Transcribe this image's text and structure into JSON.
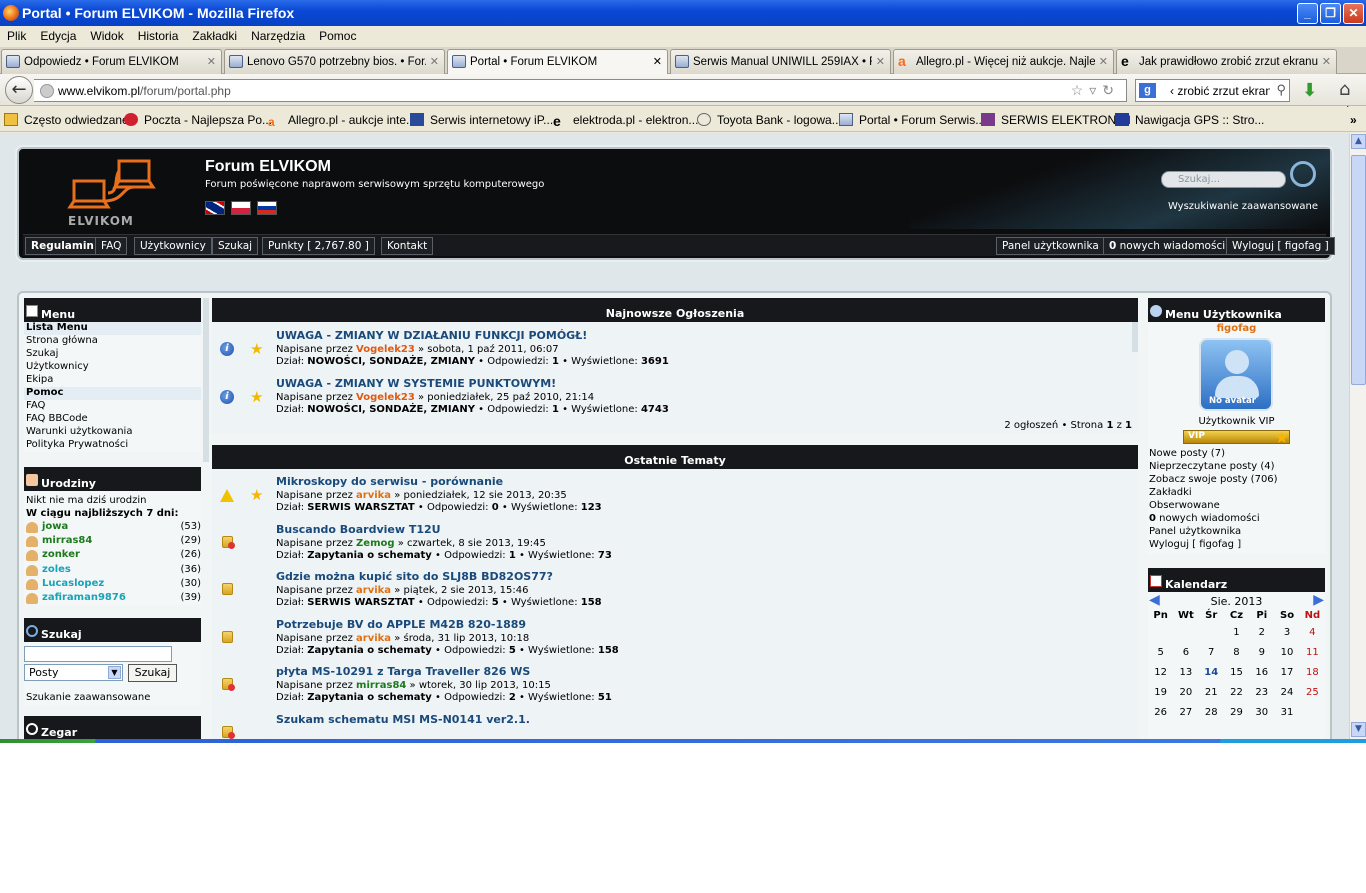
{
  "window": {
    "title": "Portal • Forum ELVIKOM - Mozilla Firefox"
  },
  "menu": [
    "Plik",
    "Edycja",
    "Widok",
    "Historia",
    "Zakładki",
    "Narzędzia",
    "Pomoc"
  ],
  "tabs": [
    {
      "label": "Odpowiedz • Forum ELVIKOM"
    },
    {
      "label": "Lenovo G570 potrzebny bios. • For..."
    },
    {
      "label": "Portal • Forum ELVIKOM"
    },
    {
      "label": "Serwis Manual UNIWILL 259IAX • F..."
    },
    {
      "label": "Allegro.pl - Więcej niż aukcje. Najle..."
    },
    {
      "label": "Jak prawidłowo zrobić zrzut ekranu..."
    }
  ],
  "nav": {
    "url_domain": "www.elvikom.pl",
    "url_path": "/forum/portal.php",
    "search_value": "‹ zrobić zrzut ekranu"
  },
  "bookmarks": [
    "Często odwiedzane",
    "Poczta - Najlepsza Po...",
    "Allegro.pl - aukcje inte...",
    "Serwis internetowy iP...",
    "elektroda.pl - elektron...",
    "Toyota Bank - logowa...",
    "Portal • Forum Serwis...",
    "SERWIS ELEKTRONIKI",
    "Nawigacja GPS :: Stro..."
  ],
  "header": {
    "logo_text": "ELVIKOM",
    "title": "Forum ELVIKOM",
    "description": "Forum poświęcone naprawom serwisowym sprzętu komputerowego",
    "search_placeholder": "Szukaj...",
    "advanced_search": "Wyszukiwanie zaawansowane",
    "nav_left": [
      "Regulamin",
      "FAQ",
      "Użytkownicy",
      "Szukaj",
      "Punkty  [ 2,767.80 ]",
      "Kontakt"
    ],
    "nav_panel": "Panel użytkownika",
    "nav_messages_count": "0",
    "nav_messages": " nowych wiadomości",
    "nav_logout": "Wyloguj [ figofag ]"
  },
  "left": {
    "menu_title": "Menu",
    "menu_items": [
      {
        "label": "Lista Menu",
        "hl": true
      },
      {
        "label": "Strona główna"
      },
      {
        "label": "Szukaj"
      },
      {
        "label": "Użytkownicy"
      },
      {
        "label": "Ekipa"
      },
      {
        "label": "Pomoc",
        "hl": true
      },
      {
        "label": "FAQ"
      },
      {
        "label": "FAQ BBCode"
      },
      {
        "label": "Warunki użytkowania"
      },
      {
        "label": "Polityka Prywatności"
      }
    ],
    "birthdays_title": "Urodziny",
    "birthdays_none": "Nikt nie ma dziś urodzin",
    "birthdays_next": "W ciągu najbliższych 7 dni:",
    "birthdays": [
      {
        "name": "jowa",
        "age": "(53)",
        "color": "#1d7a1d"
      },
      {
        "name": "mirras84",
        "age": "(29)",
        "color": "#1d7a1d"
      },
      {
        "name": "zonker",
        "age": "(26)",
        "color": "#1d7a1d"
      },
      {
        "name": "zoles",
        "age": "(36)",
        "color": "#19a3b8"
      },
      {
        "name": "Lucaslopez",
        "age": "(30)",
        "color": "#19a3b8"
      },
      {
        "name": "zafiraman9876",
        "age": "(39)",
        "color": "#19a3b8"
      }
    ],
    "search_title": "Szukaj",
    "search_select": "Posty",
    "search_button": "Szukaj",
    "search_advanced": "Szukanie zaawansowane",
    "clock_title": "Zegar"
  },
  "announcements": {
    "title": "Najnowsze Ogłoszenia",
    "items": [
      {
        "title": "UWAGA - ZMIANY W DZIAŁANIU FUNKCJI POMÓGŁ!",
        "by": "Napisane przez ",
        "author": "Vogelek23",
        "author_color": "#e05a10",
        "date": " » sobota, 1 paź 2011, 06:07",
        "forum_label": "Dział: ",
        "forum": "NOWOŚCI, SONDAŻE, ZMIANY",
        "replies_label": " • Odpowiedzi: ",
        "replies": "1",
        "views_label": " • Wyświetlone: ",
        "views": "3691"
      },
      {
        "title": "UWAGA - ZMIANY W SYSTEMIE PUNKTOWYM!",
        "by": "Napisane przez ",
        "author": "Vogelek23",
        "author_color": "#e05a10",
        "date": " » poniedziałek, 25 paź 2010, 21:14",
        "forum_label": "Dział: ",
        "forum": "NOWOŚCI, SONDAŻE, ZMIANY",
        "replies_label": " • Odpowiedzi: ",
        "replies": "1",
        "views_label": " • Wyświetlone: ",
        "views": "4743"
      }
    ],
    "pager_prefix": "2 ogłoszeń • Strona ",
    "pager_page": "1",
    "pager_mid": " z ",
    "pager_total": "1"
  },
  "topics": {
    "title": "Ostatnie Tematy",
    "items": [
      {
        "title": "Mikroskopy do serwisu - porównanie",
        "by": "Napisane przez ",
        "author": "arvika",
        "author_color": "#e07010",
        "date": " » poniedziałek, 12 sie 2013, 20:35",
        "forum_label": "Dział: ",
        "forum": "SERWIS WARSZTAT",
        "replies_label": " • Odpowiedzi: ",
        "replies": "0",
        "views_label": " • Wyświetlone: ",
        "views": "123",
        "icon": "warn",
        "star": true
      },
      {
        "title": "Buscando Boardview T12U",
        "by": "Napisane przez ",
        "author": "Zemog",
        "author_color": "#1d7a1d",
        "date": " » czwartek, 8 sie 2013, 19:45",
        "forum_label": "Dział: ",
        "forum": "Zapytania o schematy",
        "replies_label": " • Odpowiedzi: ",
        "replies": "1",
        "views_label": " • Wyświetlone: ",
        "views": "73",
        "icon": "foldx"
      },
      {
        "title": "Gdzie można kupić sito do SLJ8B BD82OS77?",
        "by": "Napisane przez ",
        "author": "arvika",
        "author_color": "#e07010",
        "date": " » piątek, 2 sie 2013, 15:46",
        "forum_label": "Dział: ",
        "forum": "SERWIS WARSZTAT",
        "replies_label": " • Odpowiedzi: ",
        "replies": "5",
        "views_label": " • Wyświetlone: ",
        "views": "158",
        "icon": "fold"
      },
      {
        "title": "Potrzebuje BV do APPLE M42B 820-1889",
        "by": "Napisane przez ",
        "author": "arvika",
        "author_color": "#e07010",
        "date": " » środa, 31 lip 2013, 10:18",
        "forum_label": "Dział: ",
        "forum": "Zapytania o schematy",
        "replies_label": " • Odpowiedzi: ",
        "replies": "5",
        "views_label": " • Wyświetlone: ",
        "views": "158",
        "icon": "fold"
      },
      {
        "title": "płyta MS-10291 z Targa Traveller 826 WS",
        "by": "Napisane przez ",
        "author": "mirras84",
        "author_color": "#1d7a1d",
        "date": " » wtorek, 30 lip 2013, 10:15",
        "forum_label": "Dział: ",
        "forum": "Zapytania o schematy",
        "replies_label": " • Odpowiedzi: ",
        "replies": "2",
        "views_label": " • Wyświetlone: ",
        "views": "51",
        "icon": "foldx"
      },
      {
        "title": "Szukam schematu MSI MS-N0141 ver2.1.",
        "by": "",
        "author": "",
        "author_color": "#c010c0",
        "date": "",
        "forum_label": "",
        "forum": "",
        "replies_label": "",
        "replies": "",
        "views_label": "",
        "views": "",
        "icon": "foldx"
      }
    ]
  },
  "right": {
    "user_menu_title": "Menu Użytkownika",
    "username": "figofag",
    "avatar_text": "No avatar",
    "rank": "Użytkownik VIP",
    "vip_badge": "VIP",
    "links": [
      "Nowe posty (7)",
      "Nieprzeczytane posty (4)",
      "Zobacz swoje posty (706)",
      "Zakładki",
      "Obserwowane"
    ],
    "msg_count": "0",
    "msg_label": " nowych wiadomości",
    "panel": "Panel użytkownika",
    "logout": "Wyloguj [ figofag ]",
    "calendar_title": "Kalendarz",
    "calendar_month": "Sie. 2013",
    "calendar_days": [
      "Pn",
      "Wt",
      "Śr",
      "Cz",
      "Pi",
      "So",
      "Nd"
    ],
    "calendar_weeks": [
      [
        "",
        "",
        "",
        "1",
        "2",
        "3",
        "4"
      ],
      [
        "5",
        "6",
        "7",
        "8",
        "9",
        "10",
        "11"
      ],
      [
        "12",
        "13",
        "14",
        "15",
        "16",
        "17",
        "18"
      ],
      [
        "19",
        "20",
        "21",
        "22",
        "23",
        "24",
        "25"
      ],
      [
        "26",
        "27",
        "28",
        "29",
        "30",
        "31",
        ""
      ]
    ],
    "today": "14"
  },
  "colors": {
    "accent": "#1a4a7a",
    "header_bg": "#0c0d0f"
  }
}
